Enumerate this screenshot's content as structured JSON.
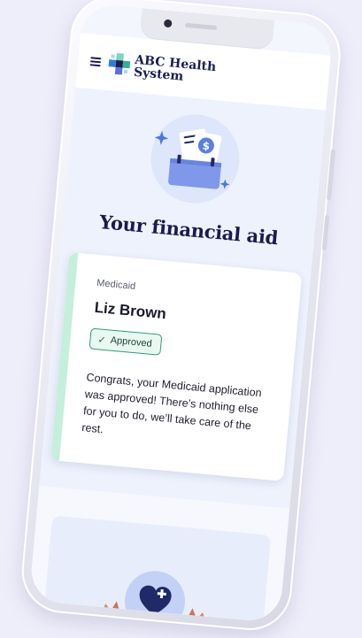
{
  "header": {
    "brand_line1": "ABC Health",
    "brand_line2": "System",
    "menu_icon": "hamburger-menu-icon",
    "logo_icon": "health-cross-logo-icon"
  },
  "page": {
    "title": "Your financial aid",
    "hero_icon": "documents-folder-dollar-icon"
  },
  "aid_card": {
    "program": "Medicaid",
    "name": "Liz Brown",
    "status": "Approved",
    "status_icon": "check-icon",
    "message": "Congrats, your Medicaid application was approved! There’s nothing else for you to do, we’ll take care of the rest."
  },
  "secondary": {
    "illustration_icon": "hands-holding-heart-icon"
  },
  "colors": {
    "brand_navy": "#1c1d55",
    "approved_border": "#2d9c7a",
    "approved_bg": "#eaf8f2",
    "card_accent": "#c6eedd",
    "hero_bg": "#dde6fb",
    "folder_blue": "#7f98ea",
    "heart_navy": "#1f2a66",
    "page_bg": "#eeeefb"
  }
}
